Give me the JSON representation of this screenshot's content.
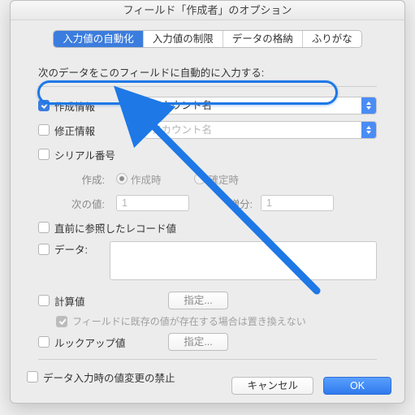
{
  "title": "フィールド「作成者」のオプション",
  "tabs": [
    "入力値の自動化",
    "入力値の制限",
    "データの格納",
    "ふりがな"
  ],
  "active_tab": 0,
  "section_label": "次のデータをこのフィールドに自動的に入力する:",
  "rows": {
    "creation": {
      "label": "作成情報",
      "checked": true,
      "select": "アカウント名"
    },
    "modification": {
      "label": "修正情報",
      "checked": false,
      "select": "アカウント名"
    },
    "serial": {
      "label": "シリアル番号",
      "checked": false
    },
    "serial_sub": {
      "create_label": "作成:",
      "radio_on_create": "作成時",
      "radio_on_commit": "確定時",
      "next_label": "次の値:",
      "next_value": "1",
      "incr_label": "増分:",
      "incr_value": "1"
    },
    "last_visited": {
      "label": "直前に参照したレコード値",
      "checked": false
    },
    "data": {
      "label": "データ:",
      "checked": false
    },
    "calc": {
      "label": "計算値",
      "checked": false,
      "button": "指定..."
    },
    "calc_hint": "フィールドに既存の値が存在する場合は置き換えない",
    "lookup": {
      "label": "ルックアップ値",
      "checked": false,
      "button": "指定..."
    },
    "prohibit": {
      "label": "データ入力時の値変更の禁止",
      "checked": false
    }
  },
  "footer": {
    "cancel": "キャンセル",
    "ok": "OK"
  },
  "colors": {
    "accent": "#3b7dde",
    "highlight": "#1e78e6"
  }
}
